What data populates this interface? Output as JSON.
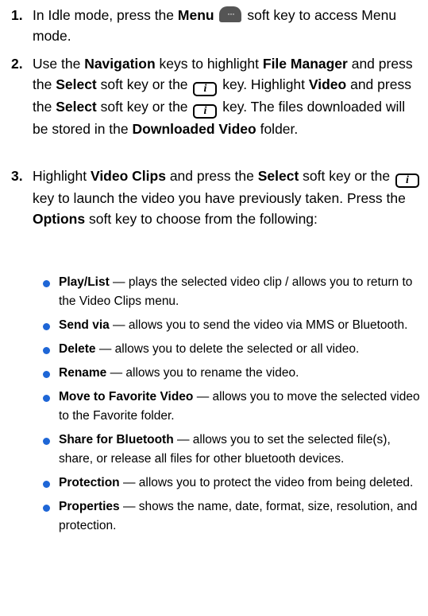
{
  "steps": [
    {
      "num": "1.",
      "t1": "In Idle mode, press the ",
      "b1": "Menu",
      "t2": " soft key to access Menu mode."
    },
    {
      "num": "2.",
      "t1": "Use the ",
      "b1": "Navigation",
      "t2": " keys to highlight ",
      "b2": "File Manager",
      "t3": " and press the ",
      "b3": "Select",
      "t4": " soft key or the ",
      "t5": " key. Highlight ",
      "b4": "Video",
      "t6": " and press the ",
      "b5": "Select",
      "t7": " soft key or the ",
      "t8": " key. The files downloaded will be stored in the ",
      "b6": "Downloaded Video",
      "t9": " folder."
    },
    {
      "num": "3.",
      "t1": "Highlight ",
      "b1": "Video Clips",
      "t2": " and press the ",
      "b2": "Select",
      "t3": " soft key or the ",
      "t4": " key to launch the video you have previously taken. Press the ",
      "b3": "Options",
      "t5": " soft key to choose from the following:"
    }
  ],
  "options": [
    {
      "term": "Play/List",
      "desc": " — plays the selected video clip / allows you to return to the Video Clips menu."
    },
    {
      "term": "Send via",
      "desc": " — allows you to send the video via MMS or Bluetooth."
    },
    {
      "term": "Delete",
      "desc": " — allows you to delete the selected or all video."
    },
    {
      "term": "Rename",
      "desc": " — allows you to rename the video."
    },
    {
      "term": "Move to Favorite Video",
      "desc": " — allows you to move the selected video to the Favorite folder."
    },
    {
      "term": "Share for Bluetooth",
      "desc": " — allows you to set the selected file(s), share, or release all files for other bluetooth devices."
    },
    {
      "term": "Protection",
      "desc": " — allows you to protect the video from being deleted."
    },
    {
      "term": "Properties",
      "desc": " — shows the name, date, format, size, resolution, and protection."
    }
  ],
  "icons": {
    "menu_key": "menu-soft-key-icon",
    "ok_key": "i-key-icon",
    "bullet_color": "#1e66d6"
  }
}
